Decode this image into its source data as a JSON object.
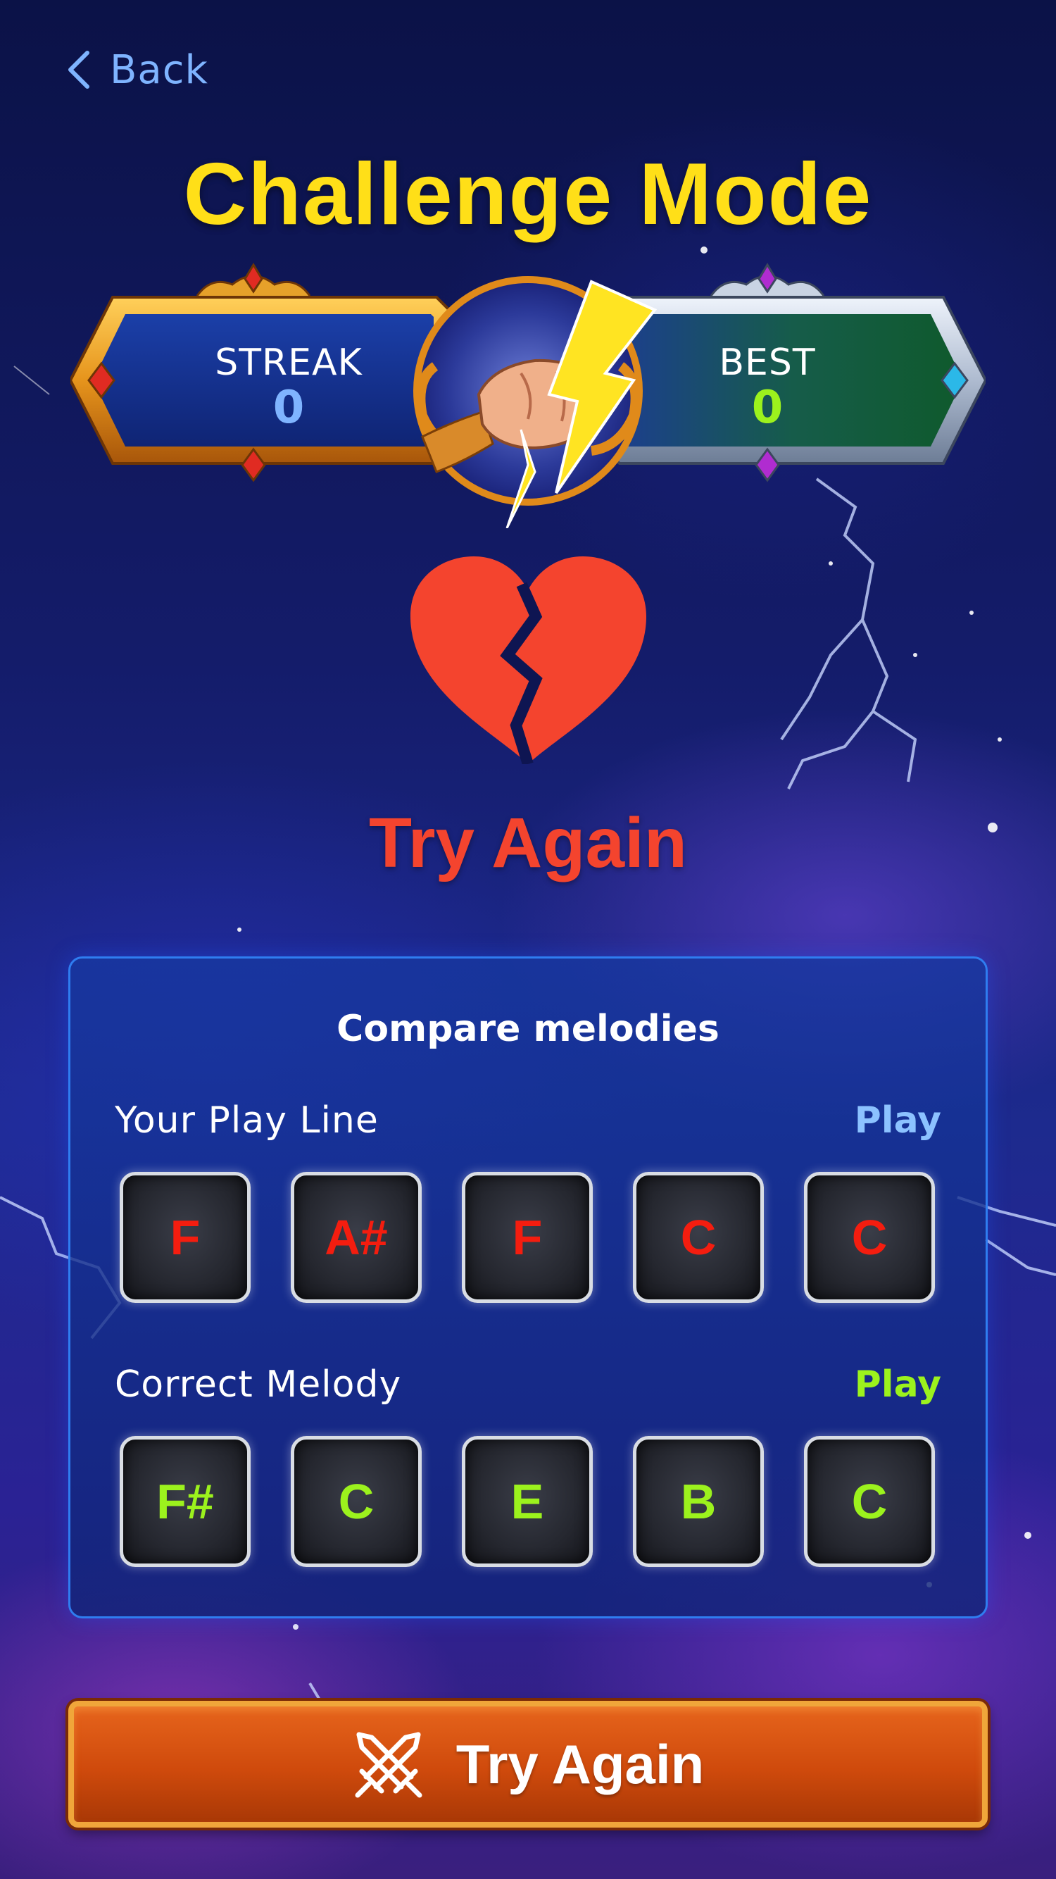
{
  "nav": {
    "back_label": "Back"
  },
  "title": "Challenge Mode",
  "scores": {
    "streak": {
      "label": "STREAK",
      "value": "0"
    },
    "best": {
      "label": "BEST",
      "value": "0"
    }
  },
  "result": {
    "text": "Try Again"
  },
  "compare": {
    "title": "Compare melodies",
    "your_line": {
      "label": "Your Play Line",
      "play_label": "Play",
      "notes": [
        "F",
        "A#",
        "F",
        "C",
        "C"
      ]
    },
    "correct_line": {
      "label": "Correct Melody",
      "play_label": "Play",
      "notes": [
        "F#",
        "C",
        "E",
        "B",
        "C"
      ]
    }
  },
  "action_button": {
    "label": "Try Again"
  },
  "colors": {
    "title": "#ffdf18",
    "back": "#7fb4ff",
    "streak_value": "#7fb4ff",
    "best_value": "#9cf21d",
    "result": "#f4442e",
    "wrong_note": "#f41d0f",
    "correct_note": "#9cf21d",
    "your_play": "#8cc2ff",
    "correct_play": "#9cf21d"
  },
  "icons": {
    "back": "chevron-left-icon",
    "banner_emblem": "fist-lightning-icon",
    "result": "broken-heart-icon",
    "button": "crossed-swords-icon"
  }
}
